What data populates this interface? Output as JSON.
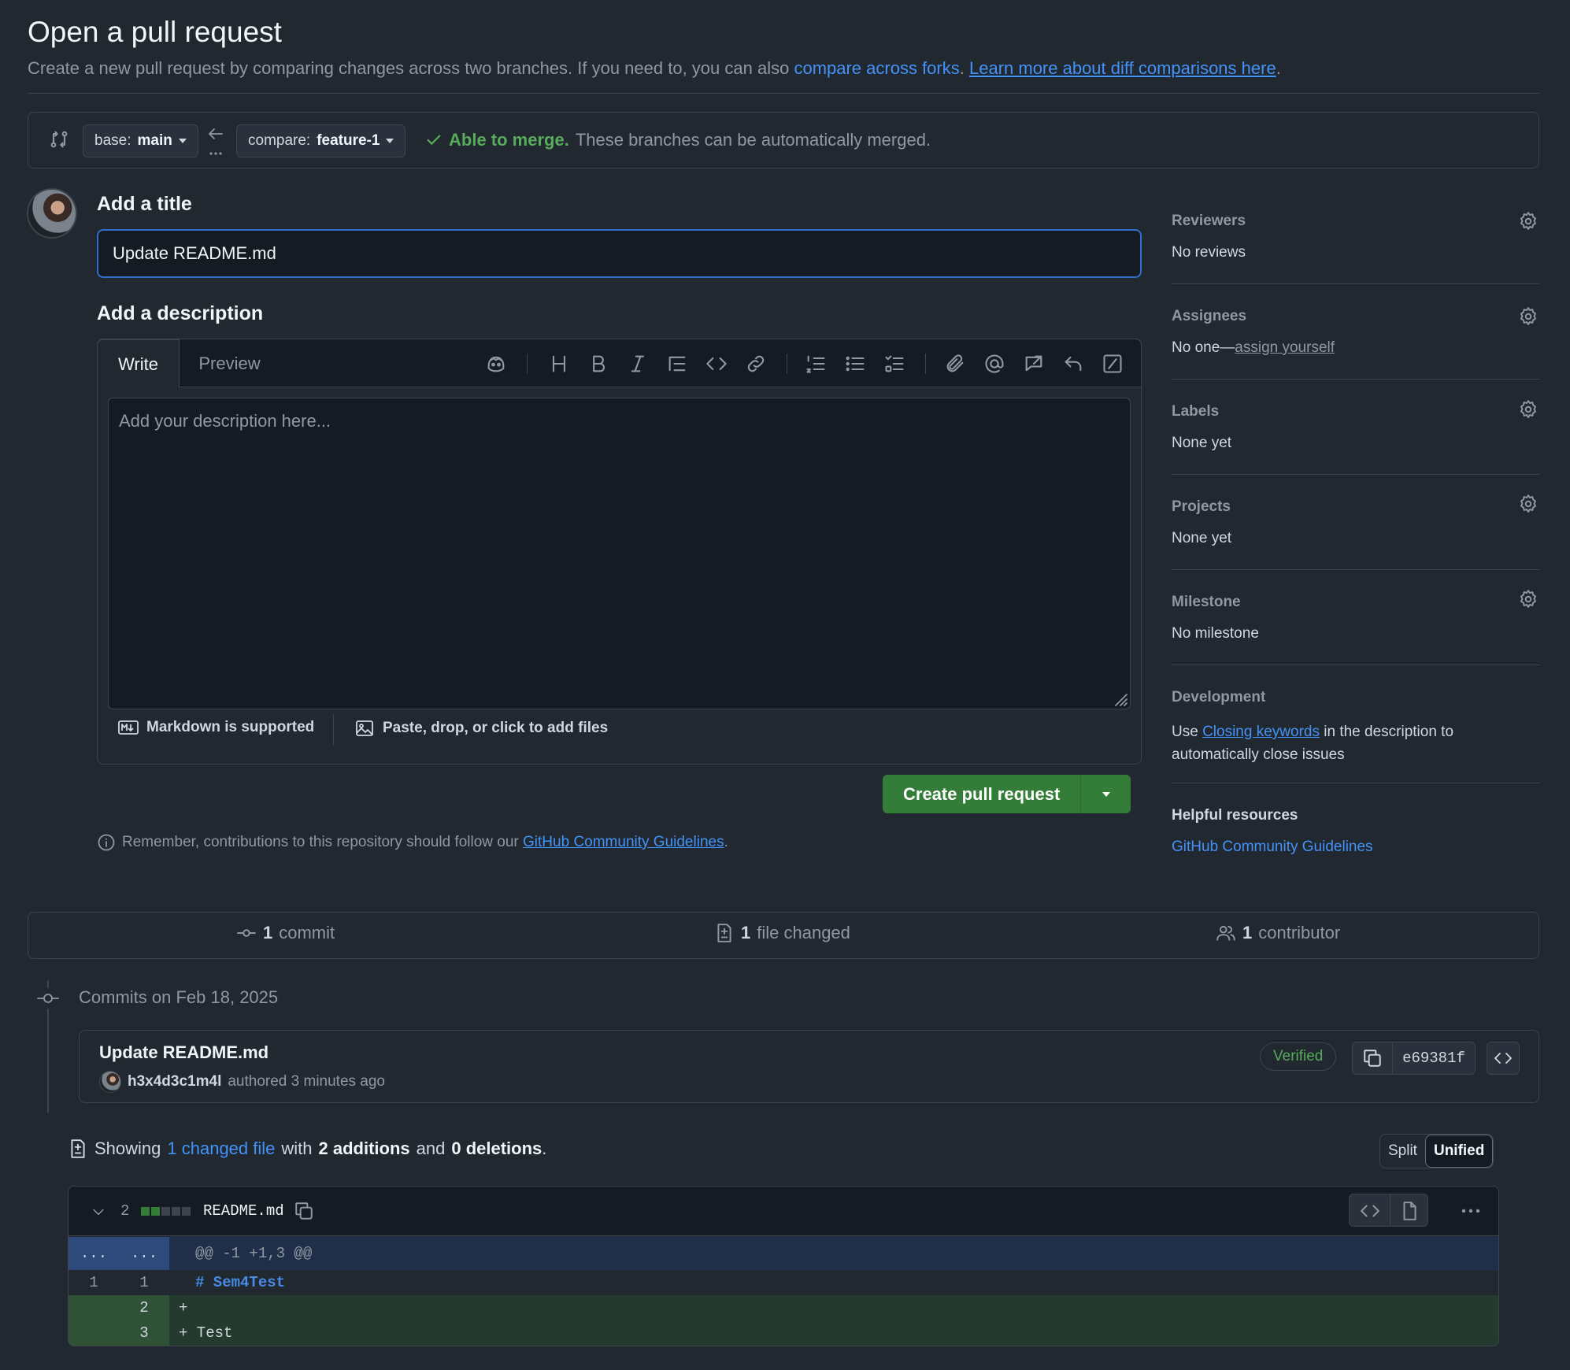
{
  "header": {
    "title": "Open a pull request",
    "subtitle_prefix": "Create a new pull request by comparing changes across two branches. If you need to, you can also ",
    "compare_forks_link": "compare across forks",
    "separator": ". ",
    "learn_more_link": "Learn more about diff comparisons here",
    "suffix": "."
  },
  "branch_bar": {
    "base_prefix": "base:",
    "base_branch": "main",
    "compare_prefix": "compare:",
    "compare_branch": "feature-1",
    "merge_status_bold": "Able to merge.",
    "merge_status_text": "These branches can be automatically merged."
  },
  "form": {
    "title_heading": "Add a title",
    "title_value": "Update README.md",
    "description_heading": "Add a description",
    "tabs": [
      "Write",
      "Preview"
    ],
    "description_placeholder": "Add your description here...",
    "markdown_note": "Markdown is supported",
    "files_note": "Paste, drop, or click to add files",
    "create_button": "Create pull request",
    "reminder_prefix": "Remember, contributions to this repository should follow our ",
    "reminder_link": "GitHub Community Guidelines",
    "reminder_suffix": "."
  },
  "toolbar_icons": [
    "copilot-icon",
    "heading-icon",
    "bold-icon",
    "italic-icon",
    "quote-icon",
    "code-icon",
    "link-icon",
    "ordered-list-icon",
    "unordered-list-icon",
    "task-list-icon",
    "attach-icon",
    "mention-icon",
    "reference-icon",
    "undo-icon",
    "slash-commands-icon"
  ],
  "sidebar": {
    "reviewers": {
      "label": "Reviewers",
      "value": "No reviews"
    },
    "assignees": {
      "label": "Assignees",
      "value_prefix": "No one—",
      "value_link": "assign yourself"
    },
    "labels": {
      "label": "Labels",
      "value": "None yet"
    },
    "projects": {
      "label": "Projects",
      "value": "None yet"
    },
    "milestone": {
      "label": "Milestone",
      "value": "No milestone"
    },
    "development": {
      "label": "Development",
      "text_prefix": "Use ",
      "link": "Closing keywords",
      "text_suffix_1": " in the description to",
      "text_suffix_2": "automatically close issues"
    },
    "helpful": {
      "label": "Helpful resources",
      "link": "GitHub Community Guidelines"
    }
  },
  "stats": {
    "commits_count": "1",
    "commits_label": "commit",
    "files_count": "1",
    "files_label": "file changed",
    "contributors_count": "1",
    "contributors_label": "contributor"
  },
  "commits": {
    "date_heading": "Commits on Feb 18, 2025",
    "items": [
      {
        "title": "Update README.md",
        "author": "h3x4d3c1m4l",
        "meta": "authored 3 minutes ago",
        "badge": "Verified",
        "sha": "e69381f"
      }
    ]
  },
  "diff_summary": {
    "showing": "Showing",
    "changed_link": "1 changed file",
    "with": "with",
    "additions": "2 additions",
    "and": "and",
    "deletions": "0 deletions",
    "period": ".",
    "split_label": "Split",
    "unified_label": "Unified"
  },
  "diff_file": {
    "changes": "2",
    "filename": "README.md",
    "hunk_left": "...",
    "hunk_right": "...",
    "hunk_header": "@@ -1 +1,3 @@",
    "lines": [
      {
        "old": "1",
        "new": "1",
        "text": "# Sem4Test",
        "kind": "context"
      },
      {
        "old": "",
        "new": "2",
        "text": "+",
        "kind": "add"
      },
      {
        "old": "",
        "new": "3",
        "text": "+ Test",
        "kind": "add"
      }
    ]
  },
  "colors": {
    "background": "#212830",
    "link": "#4493f8",
    "success": "#57ab5a",
    "primary_button": "#347d39",
    "addition_bg": "#253a2e",
    "hunk_bg": "#1f2f4a"
  }
}
